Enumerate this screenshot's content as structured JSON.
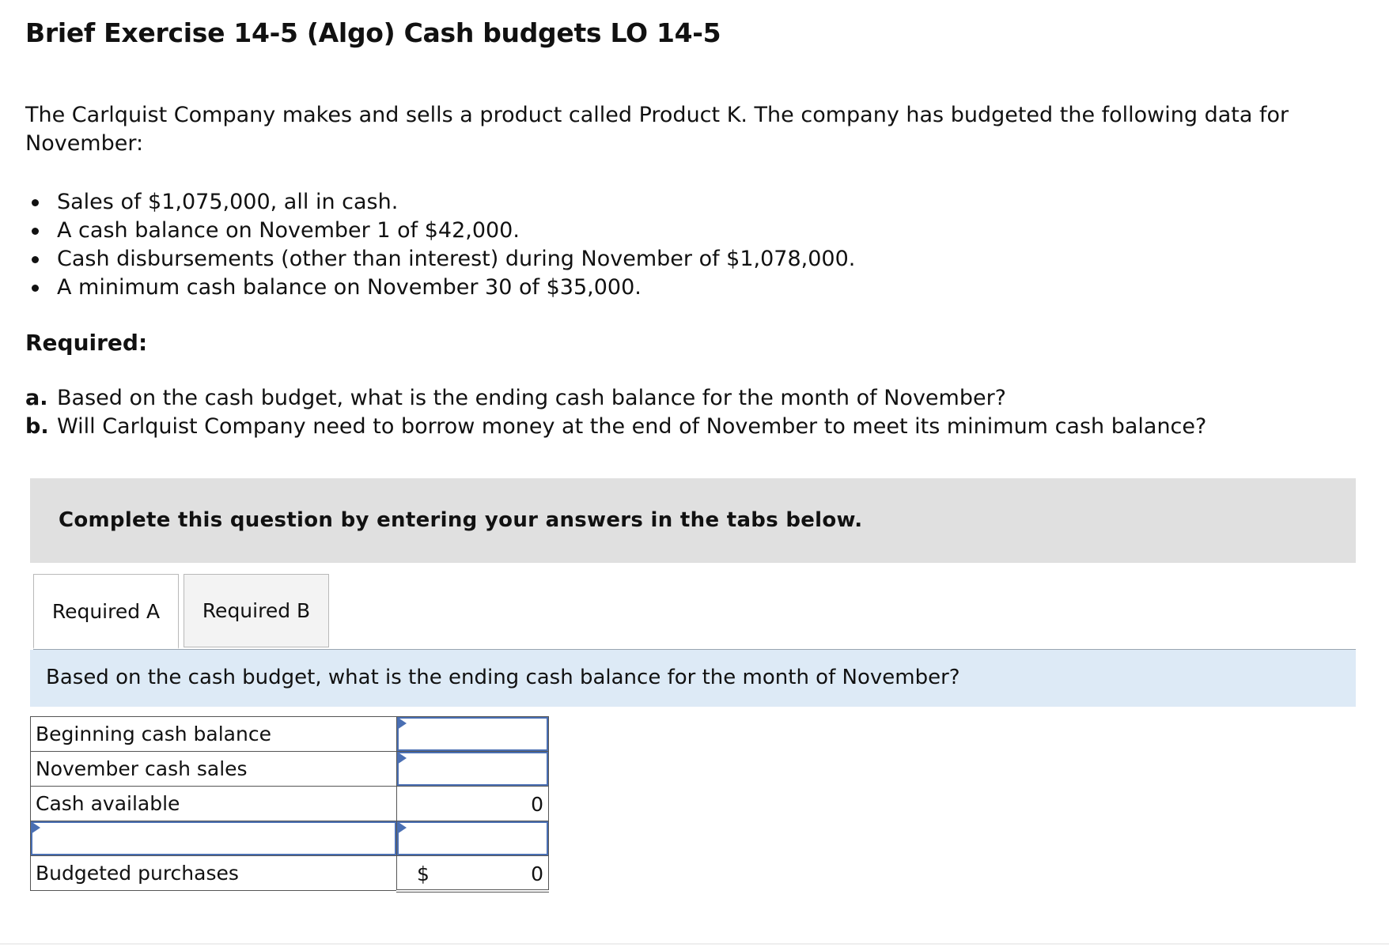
{
  "title": "Brief Exercise 14-5 (Algo) Cash budgets LO 14-5",
  "intro": "The Carlquist Company makes and sells a product called Product K. The company has budgeted the following data for November:",
  "bullets": [
    "Sales of $1,075,000, all in cash.",
    "A cash balance on November 1 of $42,000.",
    "Cash disbursements (other than interest) during November of $1,078,000.",
    "A minimum cash balance on November 30 of $35,000."
  ],
  "required_label": "Required:",
  "questions": [
    {
      "letter": "a.",
      "text": "Based on the cash budget, what is the ending cash balance for the month of November?"
    },
    {
      "letter": "b.",
      "text": "Will Carlquist Company need to borrow money at the end of November to meet its minimum cash balance?"
    }
  ],
  "instruction": "Complete this question by entering your answers in the tabs below.",
  "tabs": [
    {
      "label": "Required A",
      "active": true
    },
    {
      "label": "Required B",
      "active": false
    }
  ],
  "tab_question": "Based on the cash budget, what is the ending cash balance for the month of November?",
  "table": {
    "rows": [
      {
        "label": "Beginning cash balance",
        "value": "",
        "editable_value": true
      },
      {
        "label": "November cash sales",
        "value": "",
        "editable_value": true
      },
      {
        "label": "Cash available",
        "value": "0",
        "editable_value": false
      },
      {
        "label": "",
        "value": "",
        "editable_label": true,
        "editable_value": true
      },
      {
        "label": "Budgeted purchases",
        "currency": "$",
        "value": "0",
        "editable_value": false
      }
    ]
  },
  "colors": {
    "instruction_bg": "#e0e0e0",
    "question_bar_bg": "#ddeaf6",
    "input_border": "#4a6fb3"
  }
}
